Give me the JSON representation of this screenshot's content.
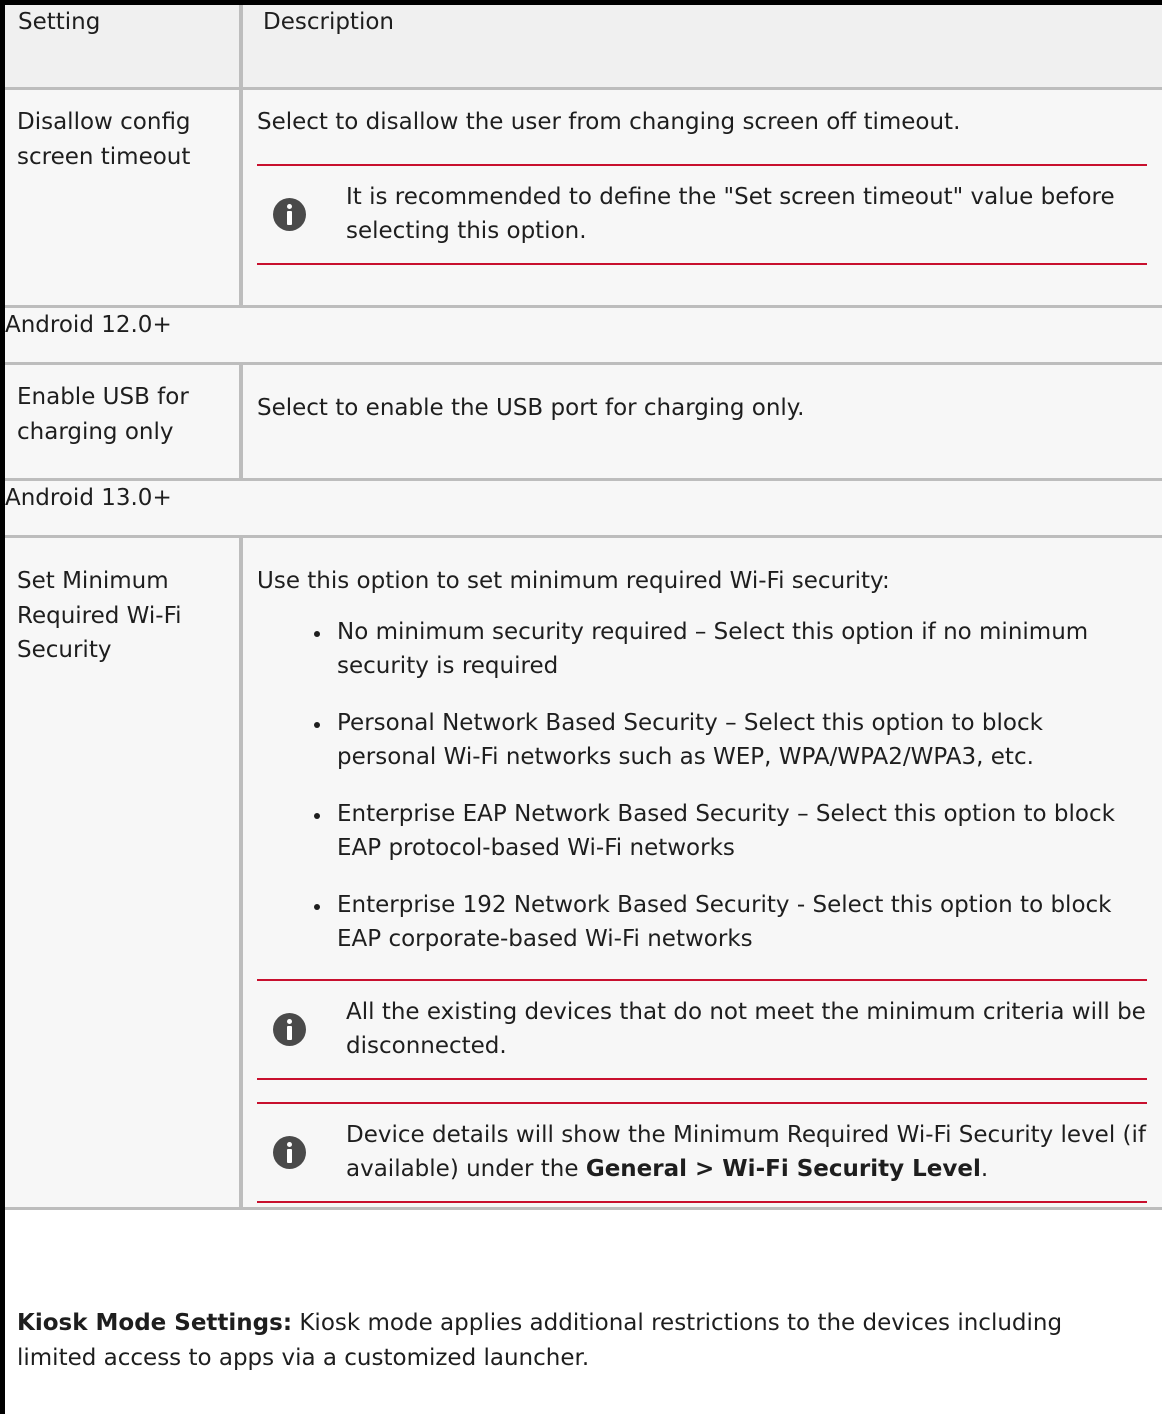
{
  "table": {
    "header": {
      "setting": "Setting",
      "description": "Description"
    },
    "row1": {
      "setting": "Disallow config screen timeout",
      "description": "Select to disallow the user from changing screen off timeout.",
      "note": "It is recommended to define the \"Set screen timeout\" value before selecting this option."
    },
    "group1": "Android 12.0+",
    "row2": {
      "setting": "Enable USB for charging only",
      "description": "Select to enable the USB port for charging only."
    },
    "group2": "Android 13.0+",
    "row3": {
      "setting": "Set Minimum Required Wi-Fi Security",
      "description": "Use this option to set minimum required Wi-Fi security:",
      "options": [
        "No minimum security required – Select this option if no minimum security is required",
        "Personal Network Based Security – Select this option to block personal Wi-Fi networks such as WEP, WPA/WPA2/WPA3, etc.",
        "Enterprise EAP Network Based Security – Select this option to block EAP protocol-based Wi-Fi networks",
        "Enterprise 192 Network Based Security - Select this option to block EAP corporate-based Wi-Fi networks"
      ],
      "note1": "All the existing devices that do not meet the minimum criteria will be disconnected.",
      "note2_prefix": "Device details will show the Minimum Required Wi-Fi Security level (if available) under the ",
      "note2_bold": "General > Wi-Fi Security Level",
      "note2_suffix": "."
    }
  },
  "footer": {
    "label": "Kiosk Mode Settings:",
    "text": " Kiosk mode applies additional restrictions to the devices including limited access to apps via a customized launcher."
  },
  "icons": {
    "note_icon": "info-icon"
  }
}
